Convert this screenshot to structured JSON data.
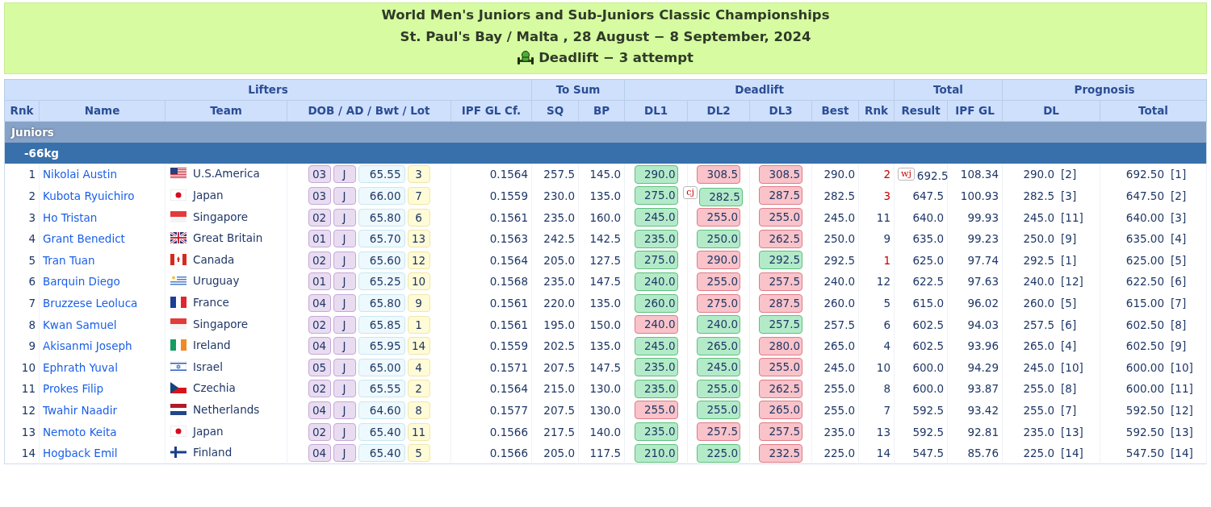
{
  "banner": {
    "title": "World Men's Juniors and Sub-Juniors Classic Championships",
    "subtitle": "St. Paul's Bay / Malta , 28 August − 8 September, 2024",
    "stage": "Deadlift − 3 attempt"
  },
  "table": {
    "groups": [
      {
        "label": "Lifters",
        "columns": [
          "Rnk",
          "Name",
          "Team",
          "DOB / AD / Bwt / Lot",
          "IPF GL Cf."
        ]
      },
      {
        "label": "To Sum",
        "columns": [
          "SQ",
          "BP"
        ]
      },
      {
        "label": "Deadlift",
        "columns": [
          "DL1",
          "DL2",
          "DL3",
          "Best",
          "Rnk"
        ]
      },
      {
        "label": "Total",
        "columns": [
          "Result",
          "IPF GL"
        ]
      },
      {
        "label": "Prognosis",
        "columns": [
          "DL",
          "Total"
        ]
      }
    ],
    "sections": [
      {
        "label": "Juniors",
        "classes": [
          {
            "label": "-66kg",
            "rows": [
              {
                "rank": "1",
                "name": "Nikolai Austin",
                "team": "U.S.America",
                "flag": {
                  "kind": "us"
                },
                "dob": "03",
                "ad": "J",
                "bwt": "65.55",
                "lot": "3",
                "cf": "0.1564",
                "sq": "257.5",
                "bp": "145.0",
                "attempts": [
                  {
                    "value": "290.0",
                    "good": true
                  },
                  {
                    "value": "308.5",
                    "good": false
                  },
                  {
                    "value": "308.5",
                    "good": false
                  }
                ],
                "best": "290.0",
                "dl_rank": "2",
                "top3": true,
                "result_note": "wj",
                "result": "692.5",
                "gl": "108.34",
                "prog_dl": "290.0",
                "prog_dl_rank": "[2]",
                "prog_total": "692.50",
                "prog_total_rank": "[1]"
              },
              {
                "rank": "2",
                "name": "Kubota Ryuichiro",
                "team": "Japan",
                "flag": {
                  "kind": "jp"
                },
                "dob": "03",
                "ad": "J",
                "bwt": "66.00",
                "lot": "7",
                "cf": "0.1559",
                "sq": "230.0",
                "bp": "135.0",
                "attempts": [
                  {
                    "value": "275.0",
                    "good": true
                  },
                  {
                    "value": "282.5",
                    "good": true,
                    "note": "cj"
                  },
                  {
                    "value": "287.5",
                    "good": false
                  }
                ],
                "best": "282.5",
                "dl_rank": "3",
                "top3": true,
                "result": "647.5",
                "gl": "100.93",
                "prog_dl": "282.5",
                "prog_dl_rank": "[3]",
                "prog_total": "647.50",
                "prog_total_rank": "[2]"
              },
              {
                "rank": "3",
                "name": "Ho Tristan",
                "team": "Singapore",
                "flag": {
                  "kind": "sg"
                },
                "dob": "02",
                "ad": "J",
                "bwt": "65.80",
                "lot": "6",
                "cf": "0.1561",
                "sq": "235.0",
                "bp": "160.0",
                "attempts": [
                  {
                    "value": "245.0",
                    "good": true
                  },
                  {
                    "value": "255.0",
                    "good": false
                  },
                  {
                    "value": "255.0",
                    "good": false
                  }
                ],
                "best": "245.0",
                "dl_rank": "11",
                "top3": false,
                "result": "640.0",
                "gl": "99.93",
                "prog_dl": "245.0",
                "prog_dl_rank": "[11]",
                "prog_total": "640.00",
                "prog_total_rank": "[3]"
              },
              {
                "rank": "4",
                "name": "Grant Benedict",
                "team": "Great Britain",
                "flag": {
                  "kind": "gb"
                },
                "dob": "01",
                "ad": "J",
                "bwt": "65.70",
                "lot": "13",
                "cf": "0.1563",
                "sq": "242.5",
                "bp": "142.5",
                "attempts": [
                  {
                    "value": "235.0",
                    "good": true
                  },
                  {
                    "value": "250.0",
                    "good": true
                  },
                  {
                    "value": "262.5",
                    "good": false
                  }
                ],
                "best": "250.0",
                "dl_rank": "9",
                "top3": false,
                "result": "635.0",
                "gl": "99.23",
                "prog_dl": "250.0",
                "prog_dl_rank": "[9]",
                "prog_total": "635.00",
                "prog_total_rank": "[4]"
              },
              {
                "rank": "5",
                "name": "Tran Tuan",
                "team": "Canada",
                "flag": {
                  "kind": "ca"
                },
                "dob": "02",
                "ad": "J",
                "bwt": "65.60",
                "lot": "12",
                "cf": "0.1564",
                "sq": "205.0",
                "bp": "127.5",
                "attempts": [
                  {
                    "value": "275.0",
                    "good": true
                  },
                  {
                    "value": "290.0",
                    "good": false
                  },
                  {
                    "value": "292.5",
                    "good": true
                  }
                ],
                "best": "292.5",
                "dl_rank": "1",
                "top3": true,
                "result": "625.0",
                "gl": "97.74",
                "prog_dl": "292.5",
                "prog_dl_rank": "[1]",
                "prog_total": "625.00",
                "prog_total_rank": "[5]"
              },
              {
                "rank": "6",
                "name": "Barquin Diego",
                "team": "Uruguay",
                "flag": {
                  "kind": "uy"
                },
                "dob": "01",
                "ad": "J",
                "bwt": "65.25",
                "lot": "10",
                "cf": "0.1568",
                "sq": "235.0",
                "bp": "147.5",
                "attempts": [
                  {
                    "value": "240.0",
                    "good": true
                  },
                  {
                    "value": "255.0",
                    "good": false
                  },
                  {
                    "value": "257.5",
                    "good": false
                  }
                ],
                "best": "240.0",
                "dl_rank": "12",
                "top3": false,
                "result": "622.5",
                "gl": "97.63",
                "prog_dl": "240.0",
                "prog_dl_rank": "[12]",
                "prog_total": "622.50",
                "prog_total_rank": "[6]"
              },
              {
                "rank": "7",
                "name": "Bruzzese Leoluca",
                "team": "France",
                "flag": {
                  "kind": "fr"
                },
                "dob": "04",
                "ad": "J",
                "bwt": "65.80",
                "lot": "9",
                "cf": "0.1561",
                "sq": "220.0",
                "bp": "135.0",
                "attempts": [
                  {
                    "value": "260.0",
                    "good": true
                  },
                  {
                    "value": "275.0",
                    "good": false
                  },
                  {
                    "value": "287.5",
                    "good": false
                  }
                ],
                "best": "260.0",
                "dl_rank": "5",
                "top3": false,
                "result": "615.0",
                "gl": "96.02",
                "prog_dl": "260.0",
                "prog_dl_rank": "[5]",
                "prog_total": "615.00",
                "prog_total_rank": "[7]"
              },
              {
                "rank": "8",
                "name": "Kwan Samuel",
                "team": "Singapore",
                "flag": {
                  "kind": "sg"
                },
                "dob": "02",
                "ad": "J",
                "bwt": "65.85",
                "lot": "1",
                "cf": "0.1561",
                "sq": "195.0",
                "bp": "150.0",
                "attempts": [
                  {
                    "value": "240.0",
                    "good": false
                  },
                  {
                    "value": "240.0",
                    "good": true
                  },
                  {
                    "value": "257.5",
                    "good": true
                  }
                ],
                "best": "257.5",
                "dl_rank": "6",
                "top3": false,
                "result": "602.5",
                "gl": "94.03",
                "prog_dl": "257.5",
                "prog_dl_rank": "[6]",
                "prog_total": "602.50",
                "prog_total_rank": "[8]"
              },
              {
                "rank": "9",
                "name": "Akisanmi Joseph",
                "team": "Ireland",
                "flag": {
                  "kind": "ie"
                },
                "dob": "04",
                "ad": "J",
                "bwt": "65.95",
                "lot": "14",
                "cf": "0.1559",
                "sq": "202.5",
                "bp": "135.0",
                "attempts": [
                  {
                    "value": "245.0",
                    "good": true
                  },
                  {
                    "value": "265.0",
                    "good": true
                  },
                  {
                    "value": "280.0",
                    "good": false
                  }
                ],
                "best": "265.0",
                "dl_rank": "4",
                "top3": false,
                "result": "602.5",
                "gl": "93.96",
                "prog_dl": "265.0",
                "prog_dl_rank": "[4]",
                "prog_total": "602.50",
                "prog_total_rank": "[9]"
              },
              {
                "rank": "10",
                "name": "Ephrath Yuval",
                "team": "Israel",
                "flag": {
                  "kind": "il"
                },
                "dob": "05",
                "ad": "J",
                "bwt": "65.00",
                "lot": "4",
                "cf": "0.1571",
                "sq": "207.5",
                "bp": "147.5",
                "attempts": [
                  {
                    "value": "235.0",
                    "good": true
                  },
                  {
                    "value": "245.0",
                    "good": true
                  },
                  {
                    "value": "255.0",
                    "good": false
                  }
                ],
                "best": "245.0",
                "dl_rank": "10",
                "top3": false,
                "result": "600.0",
                "gl": "94.29",
                "prog_dl": "245.0",
                "prog_dl_rank": "[10]",
                "prog_total": "600.00",
                "prog_total_rank": "[10]"
              },
              {
                "rank": "11",
                "name": "Prokes Filip",
                "team": "Czechia",
                "flag": {
                  "kind": "cz"
                },
                "dob": "02",
                "ad": "J",
                "bwt": "65.55",
                "lot": "2",
                "cf": "0.1564",
                "sq": "215.0",
                "bp": "130.0",
                "attempts": [
                  {
                    "value": "235.0",
                    "good": true
                  },
                  {
                    "value": "255.0",
                    "good": true
                  },
                  {
                    "value": "262.5",
                    "good": false
                  }
                ],
                "best": "255.0",
                "dl_rank": "8",
                "top3": false,
                "result": "600.0",
                "gl": "93.87",
                "prog_dl": "255.0",
                "prog_dl_rank": "[8]",
                "prog_total": "600.00",
                "prog_total_rank": "[11]"
              },
              {
                "rank": "12",
                "name": "Twahir Naadir",
                "team": "Netherlands",
                "flag": {
                  "kind": "nl"
                },
                "dob": "04",
                "ad": "J",
                "bwt": "64.60",
                "lot": "8",
                "cf": "0.1577",
                "sq": "207.5",
                "bp": "130.0",
                "attempts": [
                  {
                    "value": "255.0",
                    "good": false
                  },
                  {
                    "value": "255.0",
                    "good": true
                  },
                  {
                    "value": "265.0",
                    "good": false
                  }
                ],
                "best": "255.0",
                "dl_rank": "7",
                "top3": false,
                "result": "592.5",
                "gl": "93.42",
                "prog_dl": "255.0",
                "prog_dl_rank": "[7]",
                "prog_total": "592.50",
                "prog_total_rank": "[12]"
              },
              {
                "rank": "13",
                "name": "Nemoto Keita",
                "team": "Japan",
                "flag": {
                  "kind": "jp"
                },
                "dob": "02",
                "ad": "J",
                "bwt": "65.40",
                "lot": "11",
                "cf": "0.1566",
                "sq": "217.5",
                "bp": "140.0",
                "attempts": [
                  {
                    "value": "235.0",
                    "good": true
                  },
                  {
                    "value": "257.5",
                    "good": false
                  },
                  {
                    "value": "257.5",
                    "good": false
                  }
                ],
                "best": "235.0",
                "dl_rank": "13",
                "top3": false,
                "result": "592.5",
                "gl": "92.81",
                "prog_dl": "235.0",
                "prog_dl_rank": "[13]",
                "prog_total": "592.50",
                "prog_total_rank": "[13]"
              },
              {
                "rank": "14",
                "name": "Hogback Emil",
                "team": "Finland",
                "flag": {
                  "kind": "fi"
                },
                "dob": "04",
                "ad": "J",
                "bwt": "65.40",
                "lot": "5",
                "cf": "0.1566",
                "sq": "205.0",
                "bp": "117.5",
                "attempts": [
                  {
                    "value": "210.0",
                    "good": true
                  },
                  {
                    "value": "225.0",
                    "good": true
                  },
                  {
                    "value": "232.5",
                    "good": false
                  }
                ],
                "best": "225.0",
                "dl_rank": "14",
                "top3": false,
                "result": "547.5",
                "gl": "85.76",
                "prog_dl": "225.0",
                "prog_dl_rank": "[14]",
                "prog_total": "547.50",
                "prog_total_rank": "[14]"
              }
            ]
          }
        ]
      }
    ]
  }
}
